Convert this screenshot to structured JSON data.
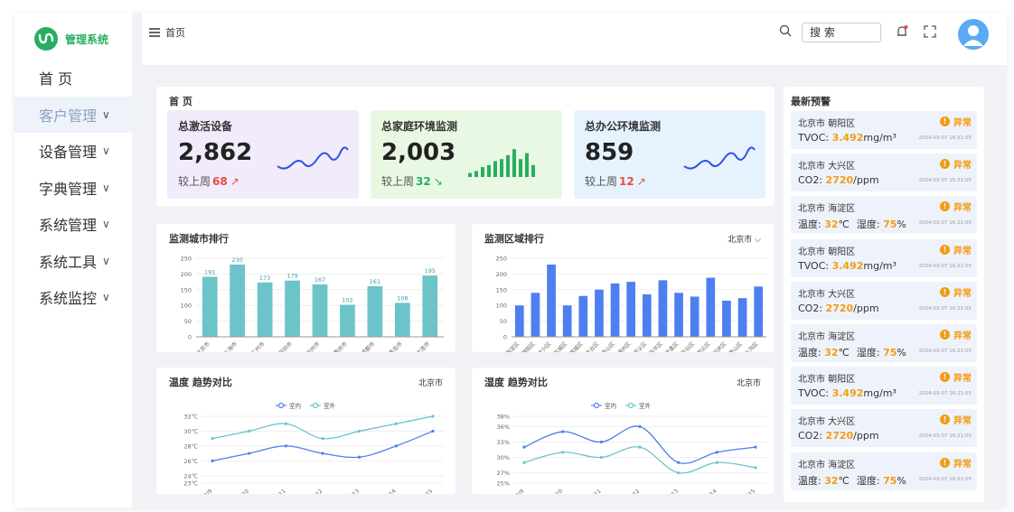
{
  "app": {
    "title": "管理系统"
  },
  "sidebar": {
    "items": [
      {
        "label": "首 页",
        "has_chevron": false,
        "active": false
      },
      {
        "label": "客户管理",
        "has_chevron": true,
        "active": true
      },
      {
        "label": "设备管理",
        "has_chevron": true,
        "active": false
      },
      {
        "label": "字典管理",
        "has_chevron": true,
        "active": false
      },
      {
        "label": "系统管理",
        "has_chevron": true,
        "active": false
      },
      {
        "label": "系统工具",
        "has_chevron": true,
        "active": false
      },
      {
        "label": "系统监控",
        "has_chevron": true,
        "active": false
      }
    ],
    "chevron": "∨"
  },
  "header": {
    "breadcrumb": "首页",
    "search_placeholder": "搜 索",
    "icons": [
      "menu-icon",
      "search-icon",
      "bell-icon",
      "fullscreen-icon",
      "avatar-icon"
    ]
  },
  "overview": {
    "title": "首 页",
    "cards": [
      {
        "label": "总激活设备",
        "value": "2,862",
        "cmp_label": "较上周",
        "cmp_value": "68",
        "trend": "↗",
        "trend_color": "#e74c3c",
        "bg": "#f1ebfc",
        "spark": "line",
        "spark_color": "#2e50e6"
      },
      {
        "label": "总家庭环境监测",
        "value": "2,003",
        "cmp_label": "较上周",
        "cmp_value": "32",
        "trend": "↘",
        "trend_color": "#27ae60",
        "bg": "#e9f8e3",
        "spark": "bar",
        "spark_color": "#27ae60",
        "spark_values": [
          2,
          3,
          5,
          6,
          8,
          9,
          11,
          14,
          9,
          12,
          6
        ]
      },
      {
        "label": "总办公环境监测",
        "value": "859",
        "cmp_label": "较上周",
        "cmp_value": "12",
        "trend": "↗",
        "trend_color": "#e74c3c",
        "bg": "#e6f3ff",
        "spark": "line",
        "spark_color": "#2e50e6"
      }
    ]
  },
  "alerts": {
    "title": "最新预警",
    "status_label": "异常",
    "items": [
      {
        "location": "北京市  朝阳区",
        "metric_label": "TVOC: ",
        "metric_value": "3.492",
        "metric_unit": "mg/m³",
        "time": "2024-03-07 16:21:05"
      },
      {
        "location": "北京市  大兴区",
        "metric_label": "CO2: ",
        "metric_value": "2720",
        "metric_unit": "/ppm",
        "time": "2024-03-07 16:21:05"
      },
      {
        "location": "北京市  海淀区",
        "metric_label": "温度: ",
        "metric_value": "32",
        "metric_unit": "℃",
        "extra_label": "湿度: ",
        "extra_value": "75",
        "extra_unit": "%",
        "time": "2024-03-07 16:21:05"
      },
      {
        "location": "北京市  朝阳区",
        "metric_label": "TVOC: ",
        "metric_value": "3.492",
        "metric_unit": "mg/m³",
        "time": "2024-03-07 16:21:05"
      },
      {
        "location": "北京市  大兴区",
        "metric_label": "CO2: ",
        "metric_value": "2720",
        "metric_unit": "/ppm",
        "time": "2024-03-07 16:21:05"
      },
      {
        "location": "北京市  海淀区",
        "metric_label": "温度: ",
        "metric_value": "32",
        "metric_unit": "℃",
        "extra_label": "湿度: ",
        "extra_value": "75",
        "extra_unit": "%",
        "time": "2024-03-07 16:21:05"
      },
      {
        "location": "北京市  朝阳区",
        "metric_label": "TVOC: ",
        "metric_value": "3.492",
        "metric_unit": "mg/m³",
        "time": "2024-03-07 16:21:05"
      },
      {
        "location": "北京市  大兴区",
        "metric_label": "CO2: ",
        "metric_value": "2720",
        "metric_unit": "/ppm",
        "time": "2024-03-07 16:21:05"
      },
      {
        "location": "北京市  海淀区",
        "metric_label": "温度: ",
        "metric_value": "32",
        "metric_unit": "℃",
        "extra_label": "湿度: ",
        "extra_value": "75",
        "extra_unit": "%",
        "time": "2024-03-07 16:21:05"
      }
    ]
  },
  "colors": {
    "accent": "#27ae60",
    "teal_bar": "#6cc4c9",
    "blue_bar": "#4f7ef0",
    "indoor": "#4f7ef0",
    "outdoor": "#6cc4c9",
    "warning": "#f39c12"
  },
  "chart_data": [
    {
      "id": "city",
      "type": "bar",
      "title": "监测城市排行",
      "categories": [
        "北京市",
        "上海市",
        "广州市",
        "深圳市",
        "杭州市",
        "重庆市",
        "成都市",
        "青岛市",
        "大连市"
      ],
      "values": [
        191,
        230,
        173,
        179,
        167,
        102,
        161,
        108,
        195
      ],
      "ylim": [
        0,
        250
      ],
      "yticks": [
        0,
        50,
        100,
        150,
        200,
        250
      ],
      "data_labels": true,
      "color": "#6cc4c9"
    },
    {
      "id": "district",
      "type": "bar",
      "title": "监测区域排行",
      "selector": "北京市",
      "categories": [
        "海淀区",
        "朝阳区",
        "大兴区",
        "东城区",
        "西城区",
        "丰台区",
        "房山区",
        "通州区",
        "顺义区",
        "昌平区",
        "怀柔区",
        "平谷区",
        "密云区",
        "延庆区",
        "石景山区",
        "门头沟区"
      ],
      "values": [
        100,
        140,
        230,
        100,
        130,
        150,
        170,
        175,
        135,
        180,
        140,
        128,
        188,
        115,
        123,
        160
      ],
      "ylim": [
        0,
        250
      ],
      "yticks": [
        0,
        50,
        100,
        150,
        200,
        250
      ],
      "data_labels": false,
      "color": "#4f7ef0"
    },
    {
      "id": "temperature",
      "type": "line",
      "title": "温度 趋势对比",
      "city": "北京市",
      "categories": [
        "9/9",
        "9/10",
        "9/11",
        "9/12",
        "9/13",
        "9/14",
        "9/15"
      ],
      "series": [
        {
          "name": "室内",
          "values": [
            26,
            27,
            28,
            27,
            26.5,
            28,
            30
          ],
          "color": "#4f7ef0"
        },
        {
          "name": "室外",
          "values": [
            29,
            30,
            31,
            29,
            30,
            31,
            32
          ],
          "color": "#6cc4c9"
        }
      ],
      "ylim": [
        23,
        32
      ],
      "yticks": [
        "23℃",
        "24℃",
        "26℃",
        "28℃",
        "30℃",
        "32℃"
      ],
      "ytick_values": [
        23,
        24,
        26,
        28,
        30,
        32
      ]
    },
    {
      "id": "humidity",
      "type": "line",
      "title": "湿度 趋势对比",
      "city": "北京市",
      "categories": [
        "9/9",
        "9/10",
        "9/11",
        "9/12",
        "9/13",
        "9/14",
        "9/15"
      ],
      "series": [
        {
          "name": "室内",
          "values": [
            32,
            35,
            33,
            36,
            29,
            31,
            32
          ],
          "color": "#4f7ef0"
        },
        {
          "name": "室外",
          "values": [
            29,
            31,
            30,
            32,
            27,
            29,
            28
          ],
          "color": "#6cc4c9"
        }
      ],
      "ylim": [
        25,
        38
      ],
      "yticks": [
        "25%",
        "27%",
        "30%",
        "33%",
        "36%",
        "38%"
      ],
      "ytick_values": [
        25,
        27,
        30,
        33,
        36,
        38
      ]
    }
  ]
}
